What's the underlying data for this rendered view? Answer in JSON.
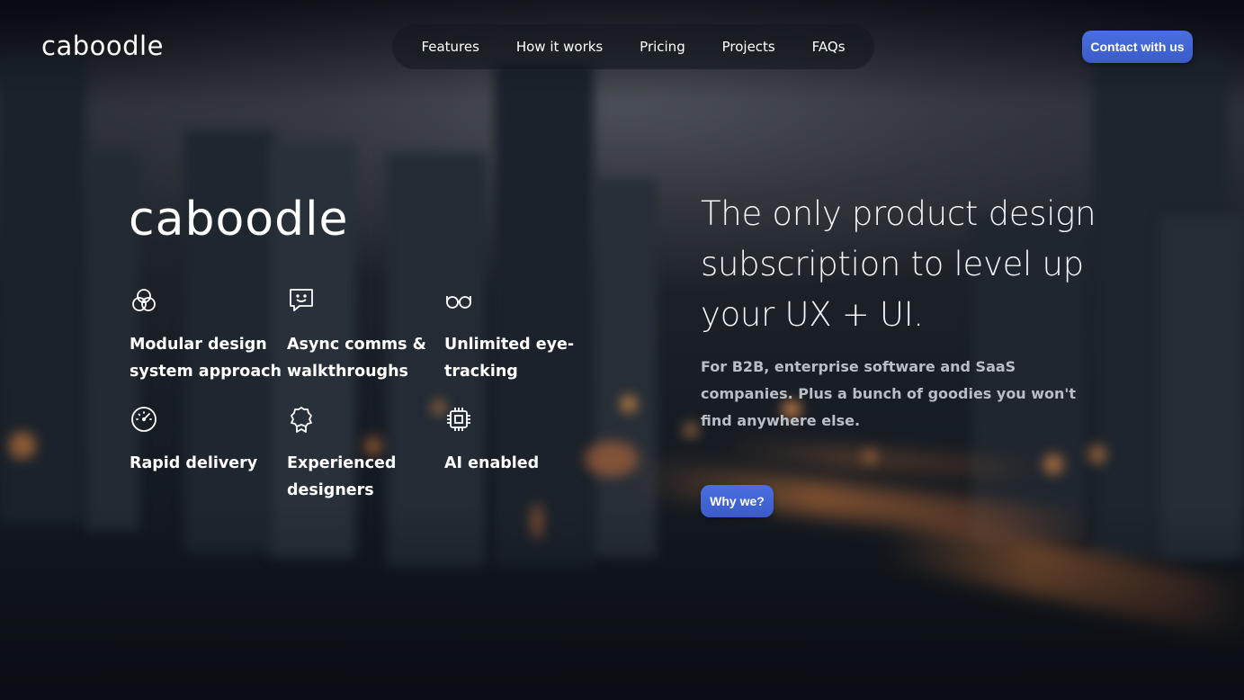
{
  "brand": {
    "logo_text": "caboodle"
  },
  "nav": {
    "items": [
      {
        "label": "Features"
      },
      {
        "label": "How it works"
      },
      {
        "label": "Pricing"
      },
      {
        "label": "Projects"
      },
      {
        "label": "FAQs"
      }
    ]
  },
  "header": {
    "cta_label": "Contact with us"
  },
  "hero": {
    "logo_text": "caboodle",
    "headline": "The only product design subscription to level up your UX + UI.",
    "subheadline": "For B2B, enterprise software and SaaS companies. Plus a bunch of goodies you won't find anywhere else.",
    "cta_label": "Why we?",
    "features": [
      {
        "icon": "overlapping-circles-icon",
        "label": "Modular design system approach"
      },
      {
        "icon": "smiley-chat-icon",
        "label": "Async comms & walkthroughs"
      },
      {
        "icon": "glasses-icon",
        "label": "Unlimited eye-tracking"
      },
      {
        "icon": "speedometer-icon",
        "label": "Rapid delivery"
      },
      {
        "icon": "award-badge-icon",
        "label": "Experienced designers"
      },
      {
        "icon": "chip-icon",
        "label": "AI enabled"
      }
    ]
  },
  "colors": {
    "accent": "#4563d6",
    "text": "#ffffff",
    "muted_text": "#b9bec6",
    "nav_bg": "#14181e"
  }
}
